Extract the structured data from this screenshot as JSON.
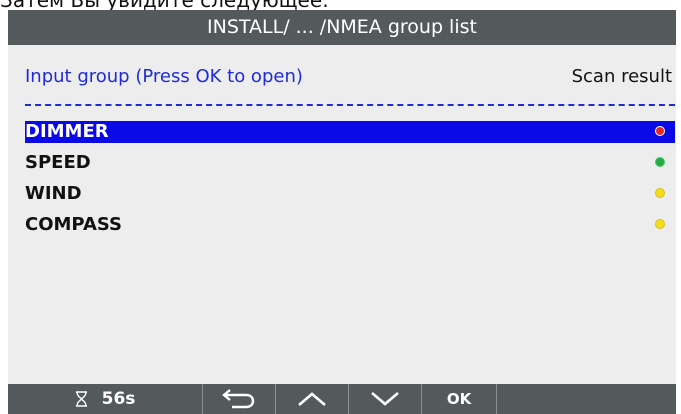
{
  "caption": "Затем Вы увидите следующее:",
  "titlebar": {
    "title": "INSTALL/ ... /NMEA group list"
  },
  "header": {
    "left": "Input group (Press OK to open)",
    "right": "Scan result"
  },
  "groups": [
    {
      "label": "DIMMER",
      "status_color": "#e8261f",
      "selected": true
    },
    {
      "label": "SPEED",
      "status_color": "#2aa84a",
      "selected": false
    },
    {
      "label": "WIND",
      "status_color": "#f2de1a",
      "selected": false
    },
    {
      "label": "COMPASS",
      "status_color": "#f2de1a",
      "selected": false
    }
  ],
  "bottom_bar": {
    "timer_icon": "hourglass-icon",
    "timer_value": "56s",
    "back_icon": "return-arrow-icon",
    "up_icon": "chevron-up-icon",
    "down_icon": "chevron-down-icon",
    "ok_label": "OK"
  },
  "colors": {
    "titlebar_bg": "#54595c",
    "accent_blue": "#1f2bd6",
    "selection_bg": "#0a0ae6",
    "panel_bg": "#ededed"
  }
}
